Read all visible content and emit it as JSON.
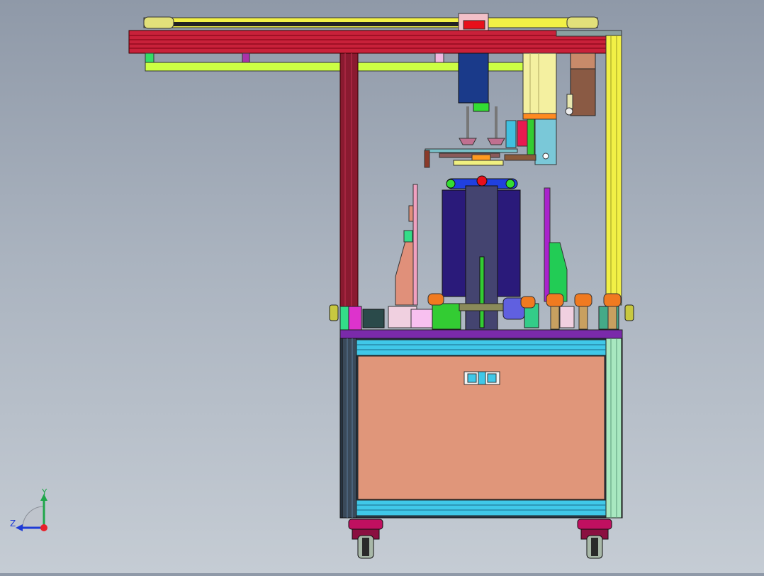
{
  "view": {
    "background_top": "#8f99a8",
    "background_bottom": "#c5ccd4"
  },
  "triad": {
    "y_label": "Y",
    "z_label": "Z",
    "y_color": "#1fa64a",
    "z_color": "#1f3bd6",
    "x_color": "#e8202a"
  }
}
